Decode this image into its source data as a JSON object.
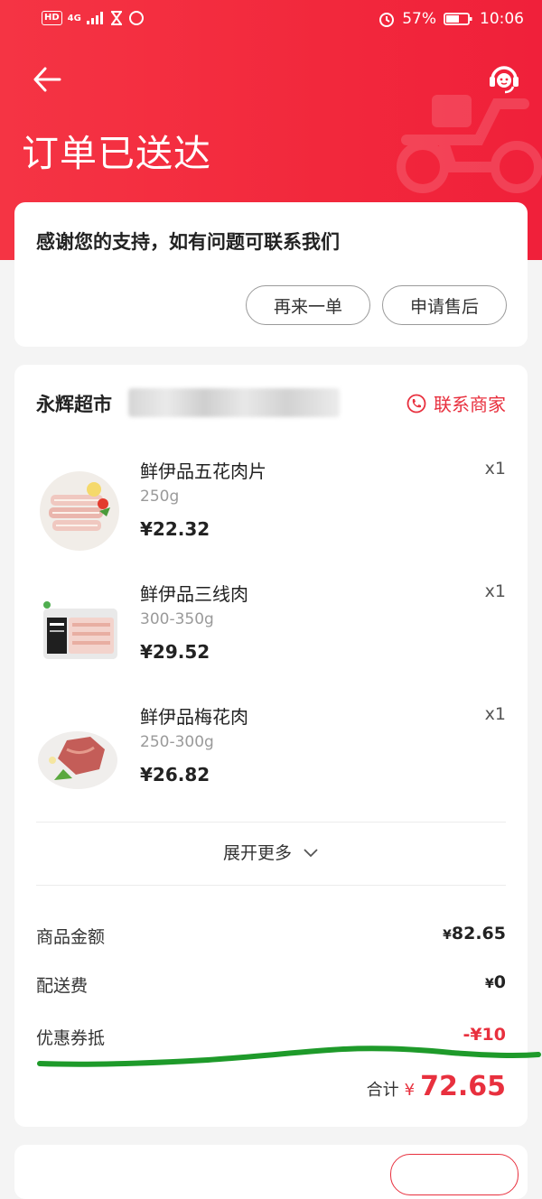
{
  "status_bar": {
    "network_hd": "HD",
    "network_4g": "4G",
    "battery_percent": "57%",
    "time": "10:06"
  },
  "header": {
    "title": "订单已送达"
  },
  "notice_card": {
    "message": "感谢您的支持，如有问题可联系我们",
    "reorder_label": "再来一单",
    "after_sales_label": "申请售后"
  },
  "store": {
    "name": "永辉超市",
    "contact_label": "联系商家"
  },
  "items": [
    {
      "name": "鲜伊品五花肉片",
      "spec": "250g",
      "price": "¥22.32",
      "qty": "x1"
    },
    {
      "name": "鲜伊品三线肉",
      "spec": "300-350g",
      "price": "¥29.52",
      "qty": "x1"
    },
    {
      "name": "鲜伊品梅花肉",
      "spec": "250-300g",
      "price": "¥26.82",
      "qty": "x1"
    }
  ],
  "expand_label": "展开更多",
  "summary": {
    "goods_label": "商品金额",
    "goods_value": "82.65",
    "delivery_label": "配送费",
    "delivery_value": "0",
    "coupon_label": "优惠券抵",
    "coupon_value": "-¥10",
    "total_label": "合计",
    "total_currency": "¥",
    "total_value": "72.65",
    "currency": "¥"
  },
  "colors": {
    "brand_red": "#f2283c",
    "accent_red": "#e8303e",
    "annotation_green": "#1e9a2a"
  }
}
